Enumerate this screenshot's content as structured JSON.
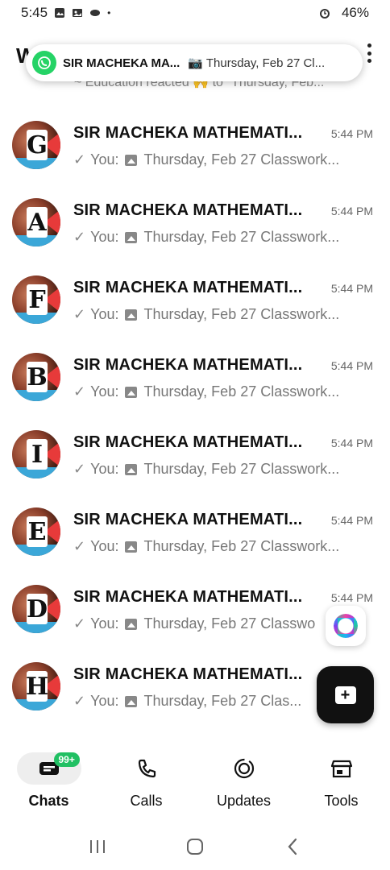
{
  "status_bar": {
    "time": "5:45",
    "battery": "46%"
  },
  "header": {
    "title": "W"
  },
  "notification": {
    "app_icon": "whatsapp-icon",
    "title": "SIR MACHEKA MA...",
    "text": "📷 Thursday, Feb 27  Cl..."
  },
  "partial_row": {
    "text": "~ Education reacted 🙌 to \"Thursday, Feb..."
  },
  "chats": [
    {
      "letter": "G",
      "name": "SIR MACHEKA MATHEMATI...",
      "time": "5:44 PM",
      "you": "You:",
      "preview": "Thursday, Feb 27  Classwork..."
    },
    {
      "letter": "A",
      "name": "SIR MACHEKA MATHEMATI...",
      "time": "5:44 PM",
      "you": "You:",
      "preview": "Thursday, Feb 27  Classwork..."
    },
    {
      "letter": "F",
      "name": "SIR MACHEKA MATHEMATI...",
      "time": "5:44 PM",
      "you": "You:",
      "preview": "Thursday, Feb 27  Classwork..."
    },
    {
      "letter": "B",
      "name": "SIR MACHEKA MATHEMATI...",
      "time": "5:44 PM",
      "you": "You:",
      "preview": "Thursday, Feb 27  Classwork..."
    },
    {
      "letter": "I",
      "name": "SIR MACHEKA MATHEMATI...",
      "time": "5:44 PM",
      "you": "You:",
      "preview": "Thursday, Feb 27  Classwork..."
    },
    {
      "letter": "E",
      "name": "SIR MACHEKA MATHEMATI...",
      "time": "5:44 PM",
      "you": "You:",
      "preview": "Thursday, Feb 27  Classwork..."
    },
    {
      "letter": "D",
      "name": "SIR MACHEKA MATHEMATI...",
      "time": "5:44 PM",
      "you": "You:",
      "preview": "Thursday, Feb 27  Classwo"
    },
    {
      "letter": "H",
      "name": "SIR MACHEKA MATHEMATI...",
      "time": "",
      "you": "You:",
      "preview": "Thursday, Feb 27  Clas..."
    }
  ],
  "bottom_nav": {
    "items": [
      {
        "label": "Chats",
        "icon": "chats-icon",
        "badge": "99+"
      },
      {
        "label": "Calls",
        "icon": "phone-icon"
      },
      {
        "label": "Updates",
        "icon": "updates-icon"
      },
      {
        "label": "Tools",
        "icon": "store-icon"
      }
    ]
  },
  "colors": {
    "accent_green": "#21c063",
    "whatsapp_green": "#25d366",
    "fab_bg": "#111111"
  }
}
